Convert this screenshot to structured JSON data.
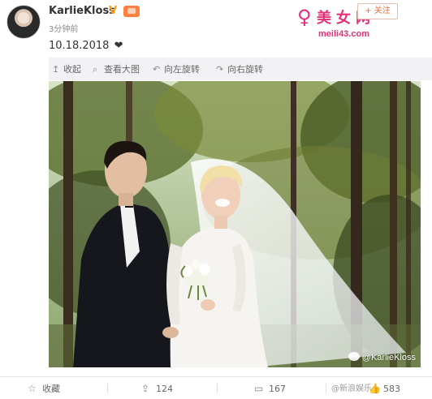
{
  "header": {
    "user_name": "KarlieKloss",
    "vip_symbol": "V",
    "time_ago": "3分钟前",
    "follow_label": "+ 关注"
  },
  "watermark": {
    "figure": "♀",
    "title": "美女网",
    "url": "meili43.com"
  },
  "post": {
    "text": "10.18.2018",
    "emoji": "❤"
  },
  "image_toolbar": {
    "collapse": "收起",
    "view_large": "查看大图",
    "rotate_left": "向左旋转",
    "rotate_right": "向右旋转"
  },
  "photo": {
    "credit": "@KarlieKloss"
  },
  "actions": {
    "collect": "收藏",
    "repost_count": "124",
    "comment_count": "167",
    "like_count": "583"
  },
  "corner_mark": "@新浪娱乐",
  "colors": {
    "accent_orange": "#e96b37",
    "watermark_pink": "#e2317a",
    "vip_gold": "#f7a21b"
  }
}
